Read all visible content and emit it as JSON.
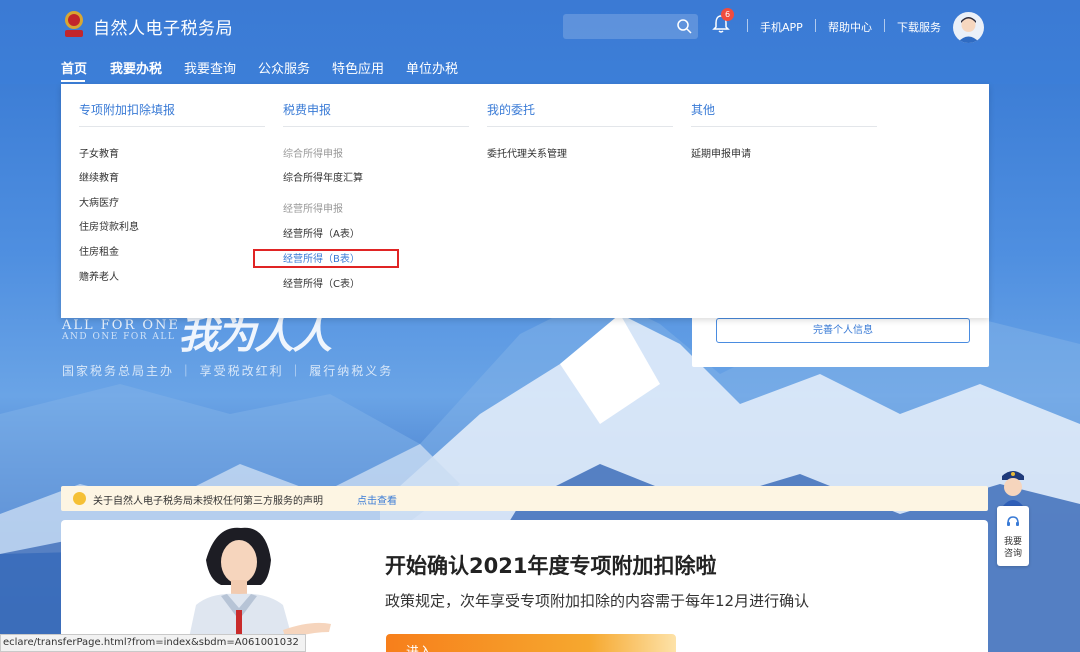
{
  "header": {
    "site_title": "自然人电子税务局",
    "notification_count": "6",
    "links": [
      "手机APP",
      "帮助中心",
      "下载服务"
    ]
  },
  "nav": {
    "items": [
      "首页",
      "我要办税",
      "我要查询",
      "公众服务",
      "特色应用",
      "单位办税"
    ]
  },
  "dropdown": {
    "columns": [
      {
        "heading": "专项附加扣除填报",
        "items": [
          "子女教育",
          "继续教育",
          "大病医疗",
          "住房贷款利息",
          "住房租金",
          "赡养老人"
        ]
      },
      {
        "heading": "税费申报",
        "group1_label": "综合所得申报",
        "group1_items": [
          "综合所得年度汇算"
        ],
        "group2_label": "经营所得申报",
        "group2_items": [
          "经营所得（A表）",
          "经营所得（B表）",
          "经营所得（C表）"
        ]
      },
      {
        "heading": "我的委托",
        "items": [
          "委托代理关系管理"
        ]
      },
      {
        "heading": "其他",
        "items": [
          "延期申报申请"
        ]
      }
    ]
  },
  "hero": {
    "slogan_en1": "ALL FOR ONE",
    "slogan_en2": "AND ONE FOR ALL",
    "slogan_script": "我为人人",
    "slogan_line": "国家税务总局主办 ｜ 享受税改红利 ｜ 履行纳税义务"
  },
  "user_card": {
    "improve_button": "完善个人信息"
  },
  "notice": {
    "text": "关于自然人电子税务局未授权任何第三方服务的声明",
    "link": "点击查看"
  },
  "banner": {
    "title": "开始确认2021年度专项附加扣除啦",
    "subtitle": "政策规定，次年享受专项附加扣除的内容需于每年12月进行确认",
    "button": "进入"
  },
  "assistant": {
    "label_line1": "我要",
    "label_line2": "咨询"
  },
  "status_url": "eclare/transferPage.html?from=index&sbdm=A061001032"
}
